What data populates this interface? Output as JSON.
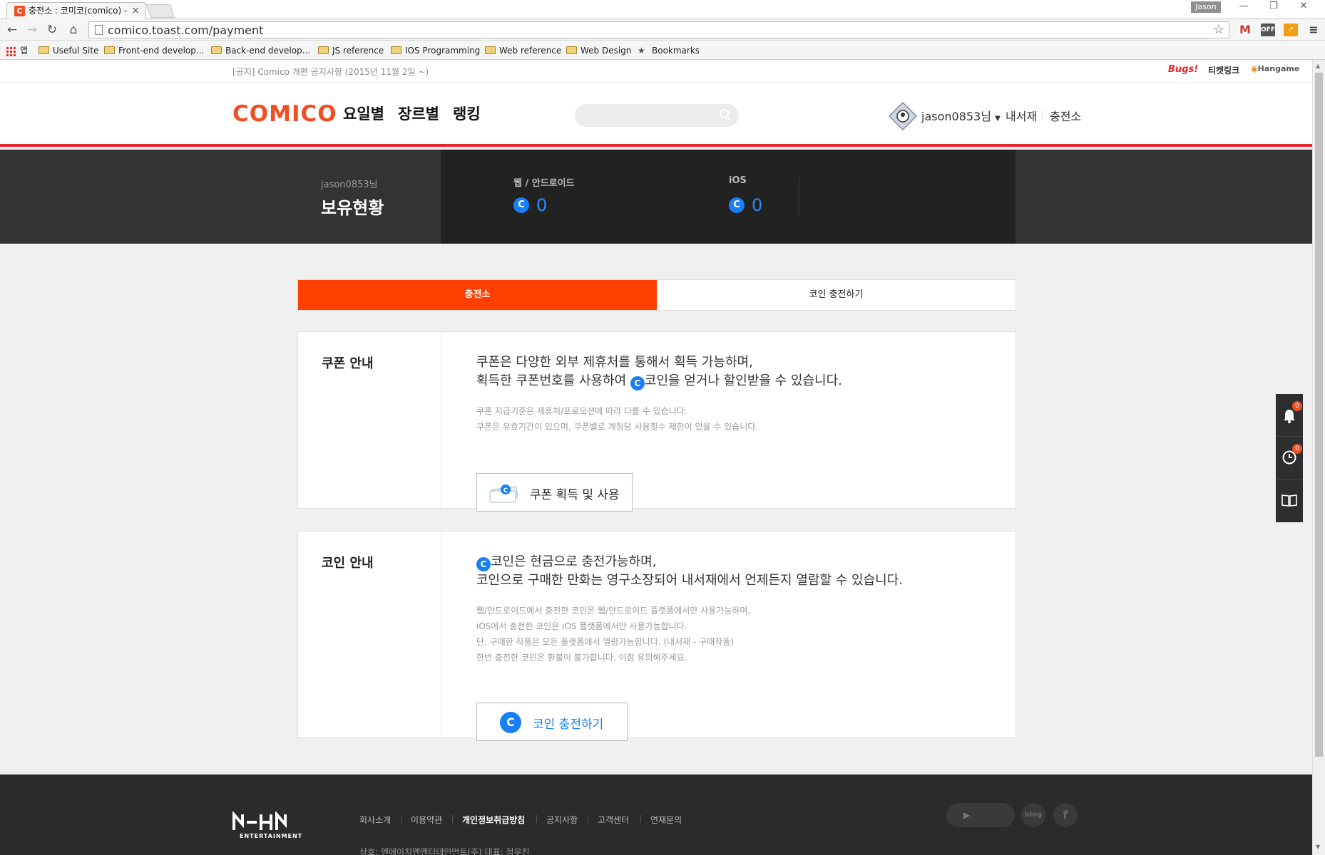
{
  "browser": {
    "tab_title": "충전소 : 코미코(comico) -",
    "profile_name": "Jason",
    "url": "comico.toast.com/payment",
    "bookmarks": [
      {
        "label": "앱",
        "type": "apps"
      },
      {
        "label": "Useful Site",
        "type": "folder"
      },
      {
        "label": "Front-end develop...",
        "type": "folder"
      },
      {
        "label": "Back-end develop...",
        "type": "folder"
      },
      {
        "label": "JS reference",
        "type": "folder"
      },
      {
        "label": "IOS Programming",
        "type": "folder"
      },
      {
        "label": "Web reference",
        "type": "folder"
      },
      {
        "label": "Web Design",
        "type": "folder"
      },
      {
        "label": "Bookmarks",
        "type": "star"
      }
    ],
    "extensions": [
      "gmail-icon",
      "adblock-off-icon",
      "chart-icon",
      "menu-icon"
    ]
  },
  "notice": "[공지] Comico 개편 공지사항 (2015년 11월 2일 ~)",
  "partners": {
    "bugs": "Bugs!",
    "ticketlink": "티켓링크",
    "hangame": "Hangame"
  },
  "gnb": {
    "logo": "COMICO",
    "menus": [
      "요일별",
      "장르별",
      "랭킹"
    ],
    "search_placeholder": "",
    "user_name": "jason0853님",
    "my_library": "내서재",
    "charge_station": "충전소"
  },
  "status": {
    "user": "jason0853님",
    "title": "보유현황",
    "web_label": "웹 / 안드로이드",
    "web_coins": "0",
    "ios_label": "iOS",
    "ios_coins": "0",
    "coin_symbol": "C"
  },
  "tabs": {
    "active": "충전소",
    "other": "코인 충전하기"
  },
  "coupon": {
    "title": "쿠폰 안내",
    "lead_1": "쿠폰은 다양한 외부 제휴처를 통해서 획득 가능하며,",
    "lead_2_pre": "획득한 쿠폰번호를 사용하여 ",
    "lead_2_post": "코인을 얻거나 할인받을 수 있습니다.",
    "note_1": "쿠폰 지급기준은 제휴처/프로모션에 따라 다를 수 있습니다.",
    "note_2": "쿠폰은 유효기간이 있으며, 쿠폰별로 계정당 사용횟수 제한이 있을 수 있습니다.",
    "button": "쿠폰 획득 및 사용"
  },
  "coin": {
    "title": "코인 안내",
    "lead_1_post": "코인은 현금으로 충전가능하며,",
    "lead_2": "코인으로 구매한 만화는 영구소장되어 내서재에서 언제든지 열람할 수 있습니다.",
    "note_1": "웹/안드로이드에서 충전한 코인은 웹/안드로이드 플랫폼에서만 사용가능하며,",
    "note_2": "iOS에서 충전한 코인은 iOS 플랫폼에서만 사용가능합니다.",
    "note_3": "단, 구매한 작품은 모든 플랫폼에서 열람가능합니다. (내서재 - 구매작품)",
    "note_4": "한번 충전한 코인은 환불이 불가합니다. 이점 유의해주세요.",
    "button": "코인 충전하기"
  },
  "side": {
    "notification_count": "0",
    "recent_count": "0"
  },
  "footer": {
    "logo_sub": "ENTERTAINMENT",
    "links": [
      "회사소개",
      "이용약관",
      "개인정보취급방침",
      "공지사항",
      "고객센터",
      "연재문의"
    ],
    "company": "상호: 엔에이치엔엔터테인먼트(주) 대표: 정우진",
    "social": [
      "play-store-icon",
      "apple-icon",
      "blog-icon",
      "facebook-icon"
    ],
    "blog_label": "blog",
    "facebook_label": "f"
  },
  "colors": {
    "brand": "#f04e23",
    "accent_tab": "#fe3f00",
    "coin_blue": "#1a7ff5",
    "status_bg": "#222222",
    "footer_bg": "#2b2b2b"
  }
}
